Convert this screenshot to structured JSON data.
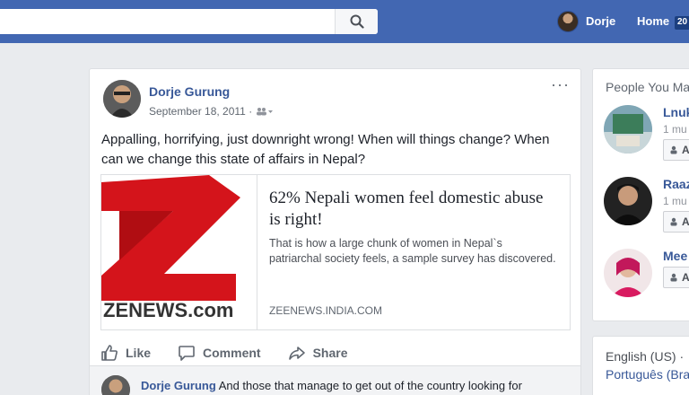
{
  "nav": {
    "user_name": "Dorje",
    "home_label": "Home",
    "badge": "20",
    "search_icon": "search-icon"
  },
  "post": {
    "author": "Dorje Gurung",
    "date": "September 18, 2011 ·",
    "more": "···",
    "text": "Appalling, horrifying, just downright wrong! When will things change? When can we change this state of affairs in Nepal?",
    "link": {
      "title": "62% Nepali women feel domestic abuse is right!",
      "description": "That is how a large chunk of women in Nepal`s patriarchal society feels, a sample survey has discovered.",
      "domain": "ZEENEWS.INDIA.COM",
      "thumb_text": "ZENEWS.com"
    },
    "actions": {
      "like": "Like",
      "comment": "Comment",
      "share": "Share"
    },
    "comment": {
      "author": "Dorje Gurung",
      "text": "And those that manage to get out of the country looking for"
    }
  },
  "sidebar": {
    "heading": "People You Ma",
    "people": [
      {
        "name": "Lnuk",
        "mutual": "1 mu",
        "button": "A"
      },
      {
        "name": "Raaz",
        "mutual": "1 mu",
        "button": "A"
      },
      {
        "name": "Mee",
        "mutual": "",
        "button": "A"
      }
    ],
    "languages": [
      "English (US) ·",
      "Português (Bra"
    ]
  },
  "colors": {
    "brand": "#4267b2",
    "link": "#385898",
    "zee_red": "#d4141b"
  }
}
